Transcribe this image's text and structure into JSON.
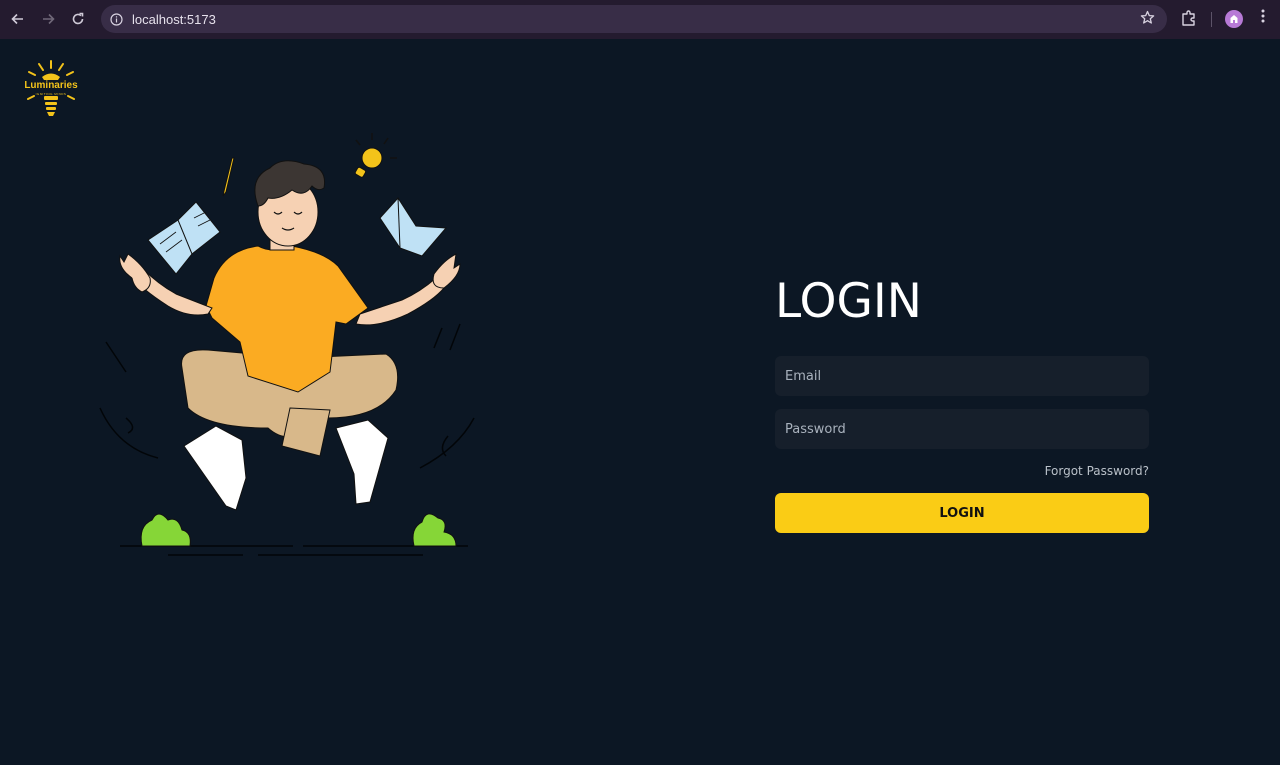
{
  "browser": {
    "url": "localhost:5173",
    "icons": {
      "back": "arrow-left-icon",
      "forward": "arrow-right-icon",
      "reload": "reload-icon",
      "site_info": "info-icon",
      "bookmark": "star-icon",
      "extensions": "puzzle-icon",
      "menu": "kebab-menu-icon"
    }
  },
  "brand": {
    "name": "Luminaries",
    "tagline": "IGNITING MINDS",
    "color": "#f3c31a"
  },
  "login": {
    "title": "LOGIN",
    "email_placeholder": "Email",
    "password_placeholder": "Password",
    "forgot_label": "Forgot Password?",
    "submit_label": "LOGIN",
    "accent": "#facc15"
  },
  "theme": {
    "background": "#0c1724",
    "input_bg": "#161f2b"
  }
}
